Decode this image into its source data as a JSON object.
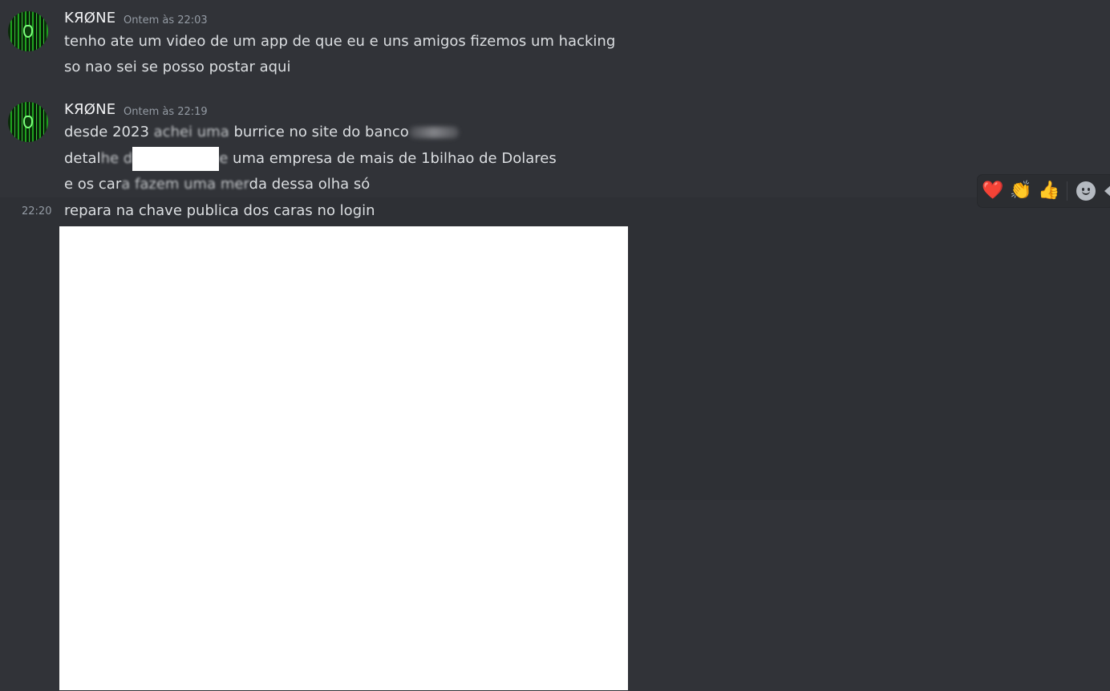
{
  "messages": [
    {
      "author": "KЯØNE",
      "time": "Ontem às 22:03",
      "lines": [
        "tenho ate um video de um app de que eu e uns amigos fizemos um hacking",
        "so nao sei se posso postar aqui"
      ]
    },
    {
      "author": "KЯØNE",
      "time": "Ontem às 22:19",
      "line1": {
        "a": "desde 2023 ",
        "b": "achei uma",
        "c": " burrice no site do banco"
      },
      "line2": {
        "a": "detal",
        "b": "he d",
        "c": "e",
        "d": " uma empresa de mais de 1bilhao de Dolares"
      },
      "line3": {
        "a": "e os car",
        "b": "a fazem uma mer",
        "c": "da dessa olha só"
      }
    },
    {
      "time": "22:20",
      "text": "repara na chave publica dos caras no login"
    }
  ],
  "reactions": {
    "quick": [
      {
        "icon": "heart-icon",
        "glyph": "❤️"
      },
      {
        "icon": "clapping-hands-icon",
        "glyph": "👏"
      },
      {
        "icon": "thumbs-up-icon",
        "glyph": "👍"
      }
    ]
  },
  "colors": {
    "background": "#313338",
    "hover_background": "#2e3035",
    "text": "#dbdee1",
    "username": "#f2f3f5",
    "muted": "#949ba4"
  }
}
